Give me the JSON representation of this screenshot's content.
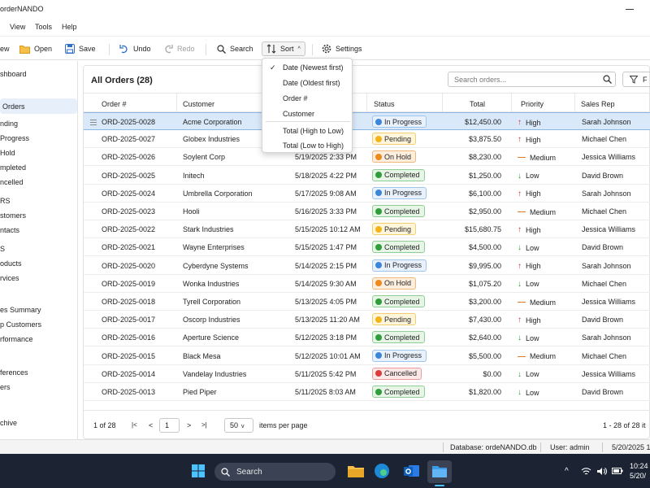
{
  "window": {
    "title": "orderNANDO"
  },
  "menu": [
    "View",
    "Tools",
    "Help"
  ],
  "toolbar": {
    "new_label": "ew",
    "open_label": "Open",
    "save_label": "Save",
    "undo_label": "Undo",
    "redo_label": "Redo",
    "search_label": "Search",
    "sort_label": "Sort",
    "settings_label": "Settings"
  },
  "sidebar": {
    "items": [
      "shboard",
      "Orders",
      "nding",
      "Progress",
      "Hold",
      "mpleted",
      "ncelled",
      "RS",
      "stomers",
      "ntacts",
      "S",
      "oducts",
      "rvices",
      "es Summary",
      "p Customers",
      "rformance",
      "ferences",
      "ers",
      "chive"
    ]
  },
  "main": {
    "title": "All Orders (28)",
    "search_placeholder": "Search orders...",
    "filter_label": "F",
    "columns": [
      "Order #",
      "Customer",
      "Status",
      "Total",
      "Priority",
      "Sales Rep"
    ],
    "rows": [
      {
        "order": "ORD-2025-0028",
        "customer": "Acme Corporation",
        "date": "",
        "status": "In Progress",
        "total": "$12,450.00",
        "priority": "High",
        "rep": "Sarah Johnson"
      },
      {
        "order": "ORD-2025-0027",
        "customer": "Globex Industries",
        "date": "",
        "status": "Pending",
        "total": "$3,875.50",
        "priority": "High",
        "rep": "Michael Chen"
      },
      {
        "order": "ORD-2025-0026",
        "customer": "Soylent Corp",
        "date": "5/19/2025 2:33 PM",
        "status": "On Hold",
        "total": "$8,230.00",
        "priority": "Medium",
        "rep": "Jessica Williams"
      },
      {
        "order": "ORD-2025-0025",
        "customer": "Initech",
        "date": "5/18/2025 4:22 PM",
        "status": "Completed",
        "total": "$1,250.00",
        "priority": "Low",
        "rep": "David Brown"
      },
      {
        "order": "ORD-2025-0024",
        "customer": "Umbrella Corporation",
        "date": "5/17/2025 9:08 AM",
        "status": "In Progress",
        "total": "$6,100.00",
        "priority": "High",
        "rep": "Sarah Johnson"
      },
      {
        "order": "ORD-2025-0023",
        "customer": "Hooli",
        "date": "5/16/2025 3:33 PM",
        "status": "Completed",
        "total": "$2,950.00",
        "priority": "Medium",
        "rep": "Michael Chen"
      },
      {
        "order": "ORD-2025-0022",
        "customer": "Stark Industries",
        "date": "5/15/2025 10:12 AM",
        "status": "Pending",
        "total": "$15,680.75",
        "priority": "High",
        "rep": "Jessica Williams"
      },
      {
        "order": "ORD-2025-0021",
        "customer": "Wayne Enterprises",
        "date": "5/15/2025 1:47 PM",
        "status": "Completed",
        "total": "$4,500.00",
        "priority": "Low",
        "rep": "David Brown"
      },
      {
        "order": "ORD-2025-0020",
        "customer": "Cyberdyne Systems",
        "date": "5/14/2025 2:15 PM",
        "status": "In Progress",
        "total": "$9,995.00",
        "priority": "High",
        "rep": "Sarah Johnson"
      },
      {
        "order": "ORD-2025-0019",
        "customer": "Wonka Industries",
        "date": "5/14/2025 9:30 AM",
        "status": "On Hold",
        "total": "$1,075.20",
        "priority": "Low",
        "rep": "Michael Chen"
      },
      {
        "order": "ORD-2025-0018",
        "customer": "Tyrell Corporation",
        "date": "5/13/2025 4:05 PM",
        "status": "Completed",
        "total": "$3,200.00",
        "priority": "Medium",
        "rep": "Jessica Williams"
      },
      {
        "order": "ORD-2025-0017",
        "customer": "Oscorp Industries",
        "date": "5/13/2025 11:20 AM",
        "status": "Pending",
        "total": "$7,430.00",
        "priority": "High",
        "rep": "David Brown"
      },
      {
        "order": "ORD-2025-0016",
        "customer": "Aperture Science",
        "date": "5/12/2025 3:18 PM",
        "status": "Completed",
        "total": "$2,640.00",
        "priority": "Low",
        "rep": "Sarah Johnson"
      },
      {
        "order": "ORD-2025-0015",
        "customer": "Black Mesa",
        "date": "5/12/2025 10:01 AM",
        "status": "In Progress",
        "total": "$5,500.00",
        "priority": "Medium",
        "rep": "Michael Chen"
      },
      {
        "order": "ORD-2025-0014",
        "customer": "Vandelay Industries",
        "date": "5/11/2025 5:42 PM",
        "status": "Cancelled",
        "total": "$0.00",
        "priority": "Low",
        "rep": "Jessica Williams"
      },
      {
        "order": "ORD-2025-0013",
        "customer": "Pied Piper",
        "date": "5/11/2025 8:03 AM",
        "status": "Completed",
        "total": "$1,820.00",
        "priority": "Low",
        "rep": "David Brown"
      }
    ],
    "pager": {
      "page_of": "1 of 28",
      "page": "1",
      "per_page": "50",
      "per_page_label": "items per page",
      "range": "1 - 28 of 28 it"
    }
  },
  "sort_menu": {
    "items": [
      "Date (Newest first)",
      "Date (Oldest first)",
      "Order #",
      "Customer",
      "Total (High to Low)",
      "Total (Low to High)"
    ],
    "checked": 0
  },
  "status_bar": {
    "database": "Database: ordeNANDO.db",
    "user": "User: admin",
    "date": "5/20/2025 1"
  },
  "taskbar": {
    "search_label": "Search",
    "time": "10:24",
    "date": "5/20/"
  },
  "colors": {
    "accent": "#3a87d8",
    "selection": "#d9e9f9",
    "taskbar": "#1c2434"
  }
}
